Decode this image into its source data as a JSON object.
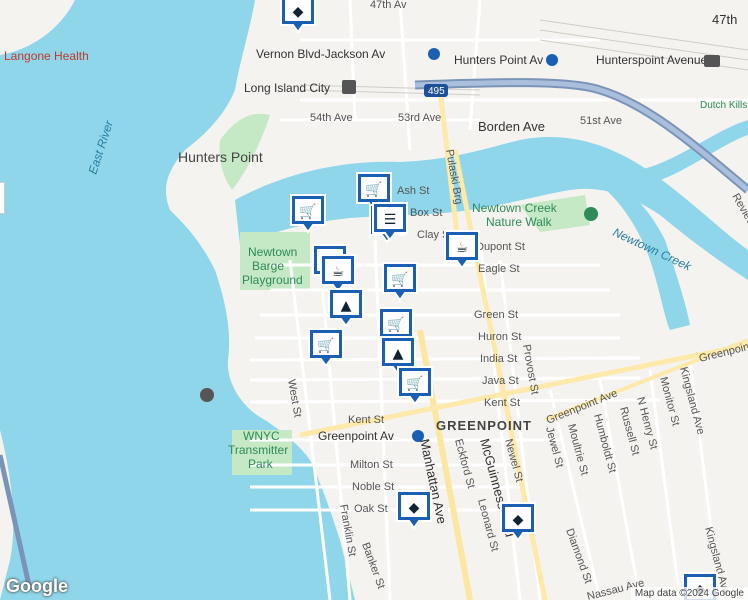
{
  "map": {
    "places": {
      "hunters_point": "Hunters Point",
      "greenpoint": "GREENPOINT",
      "langone": "Langone Health",
      "newtown_creek_walk": "Newtown Creek Nature Walk",
      "newtown_barge": "Newtown Barge Playground",
      "wnyc": "WNYC Transmitter Park",
      "dutch_kills": "Dutch Kills"
    },
    "water": {
      "east_river": "East River",
      "newtown_creek": "Newtown Creek"
    },
    "transit": {
      "vernon_jackson": "Vernon Blvd-Jackson Av",
      "hunters_point_av": "Hunters Point Av",
      "hunterspoint_avenue": "Hunterspoint Avenue",
      "lic": "Long Island City",
      "greenpoint_av": "Greenpoint Av",
      "i495": "495"
    },
    "streets": {
      "ave47": "47th Av",
      "ave47_top": "47th",
      "ave54": "54th Ave",
      "ave53": "53rd Ave",
      "borden": "Borden Ave",
      "ave51": "51st Ave",
      "ash": "Ash St",
      "box": "Box St",
      "clay": "Clay St",
      "dupont": "Dupont St",
      "eagle": "Eagle St",
      "green": "Green St",
      "huron": "Huron St",
      "india": "India St",
      "java": "Java St",
      "kent": "Kent St",
      "kent2": "Kent St",
      "greenpoint_ave": "Greenpoint Ave",
      "greenpoint_ave2": "Greenpoint Ave",
      "milton": "Milton St",
      "noble": "Noble St",
      "oak": "Oak St",
      "west": "West St",
      "franklin": "Franklin St",
      "manhattan": "Manhattan Ave",
      "eckford": "Eckford St",
      "mcguinness": "McGuinness Blvd",
      "leonard": "Leonard St",
      "newel": "Newel St",
      "provost": "Provost St",
      "jewel": "Jewel St",
      "moultrie": "Moultrie St",
      "humboldt": "Humboldt St",
      "russell": "Russell St",
      "nhenry": "N Henry St",
      "monitor": "Monitor St",
      "kingsland": "Kingsland Ave",
      "kingsland2": "Kingsland Ave",
      "diamond": "Diamond St",
      "banker": "Banker St",
      "nassau": "Nassau Ave",
      "pulaski": "Pulaski Brg",
      "review": "Review",
      "ave_stub": "Av"
    },
    "pins": [
      {
        "type": "school-icon"
      },
      {
        "type": "shopping-cart-icon"
      },
      {
        "type": "shopping-cart-icon"
      },
      {
        "type": "restaurant-icon"
      },
      {
        "type": "coffee-icon"
      },
      {
        "type": "coffee-icon"
      },
      {
        "type": "coffee-icon"
      },
      {
        "type": "shopping-bag-icon"
      },
      {
        "type": "restaurant-icon"
      },
      {
        "type": "shopping-bag-icon"
      },
      {
        "type": "shopping-cart-icon"
      },
      {
        "type": "shopping-cart-icon"
      },
      {
        "type": "shopping-bag-icon"
      },
      {
        "type": "shopping-cart-icon"
      },
      {
        "type": "shopping-cart-icon"
      },
      {
        "type": "school-icon"
      },
      {
        "type": "school-icon"
      },
      {
        "type": "school-icon"
      }
    ],
    "attribution": "Map data ©2024 Google",
    "logo": "Google"
  },
  "colors": {
    "water": "#8fd6ea",
    "land": "#f5f3f0",
    "park": "#c5e8c5",
    "pin_bg": "#1a5fb4",
    "highway": "#7a94b8"
  }
}
